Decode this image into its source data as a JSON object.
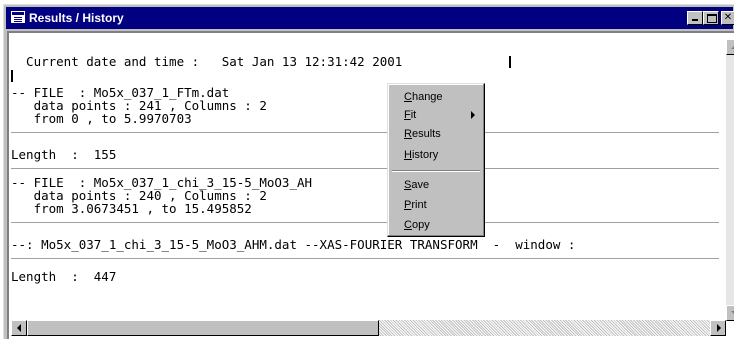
{
  "window": {
    "title": "Results / History",
    "icon": "window-app-icon",
    "buttons": {
      "minimize": "minimize-icon",
      "maximize": "maximize-icon",
      "close": "✕"
    }
  },
  "content": {
    "lines": [
      "  Current date and time :   Sat Jan 13 12:31:42 2001",
      "-- FILE  : Mo5x_037_1_FTm.dat",
      "   data points : 241 , Columns : 2",
      "   from 0 , to 5.9970703",
      "Length  :  155",
      "-- FILE  : Mo5x_037_1_chi_3_15-5_MoO3_AH",
      "   data points : 240 , Columns : 2",
      "   from 3.0673451 , to 15.495852",
      "--: Mo5x_037_1_chi_3_15-5_MoO3_AHM.dat --XAS-FOURIER TRANSFORM  -  window :",
      "Length  :  447"
    ]
  },
  "context_menu": {
    "items": [
      {
        "label": "Change"
      },
      {
        "label": "Fit",
        "submenu": true
      },
      {
        "label": "Results"
      },
      {
        "label": "History"
      },
      {
        "label": "Save"
      },
      {
        "label": "Print"
      },
      {
        "label": "Copy"
      }
    ]
  },
  "colors": {
    "titlebar": "#000080",
    "chrome": "#c0c0c0",
    "background": "#ffffff"
  }
}
